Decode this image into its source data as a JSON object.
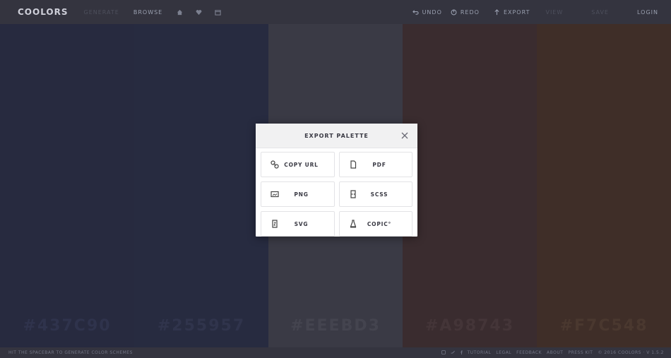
{
  "app": {
    "logo": "COOLORS"
  },
  "topbar": {
    "faint_item": "GENERATE",
    "browse": "BROWSE",
    "undo": "UNDO",
    "redo": "REDO",
    "export": "EXPORT",
    "faint_right_1": "VIEW",
    "faint_right_2": "SAVE",
    "login": "LOGIN"
  },
  "palette": [
    {
      "hex": "#437C90",
      "bg": "#272a3f",
      "text_color": "#2f334c"
    },
    {
      "hex": "#255957",
      "bg": "#272b40",
      "text_color": "#30344c"
    },
    {
      "hex": "#EEEBD3",
      "bg": "#3a3a45",
      "text_color": "#44444f"
    },
    {
      "hex": "#A98743",
      "bg": "#3a2c2f",
      "text_color": "#443538"
    },
    {
      "hex": "#F7C548",
      "bg": "#3f2e28",
      "text_color": "#4a382f"
    }
  ],
  "modal": {
    "title": "EXPORT PALETTE",
    "options": [
      {
        "label": "COPY URL",
        "icon": "link-icon"
      },
      {
        "label": "PDF",
        "icon": "file-icon"
      },
      {
        "label": "PNG",
        "icon": "image-icon"
      },
      {
        "label": "SCSS",
        "icon": "code-file-icon"
      },
      {
        "label": "SVG",
        "icon": "svg-file-icon"
      },
      {
        "label": "COPIC°",
        "icon": "marker-icon"
      }
    ]
  },
  "footer": {
    "left_text": "HIT THE SPACEBAR TO GENERATE COLOR SCHEMES",
    "links": [
      "TUTORIAL",
      "LEGAL",
      "FEEDBACK",
      "ABOUT",
      "PRESS KIT"
    ],
    "copyright": "© 2016 COOLORS · V 1.5.2"
  }
}
